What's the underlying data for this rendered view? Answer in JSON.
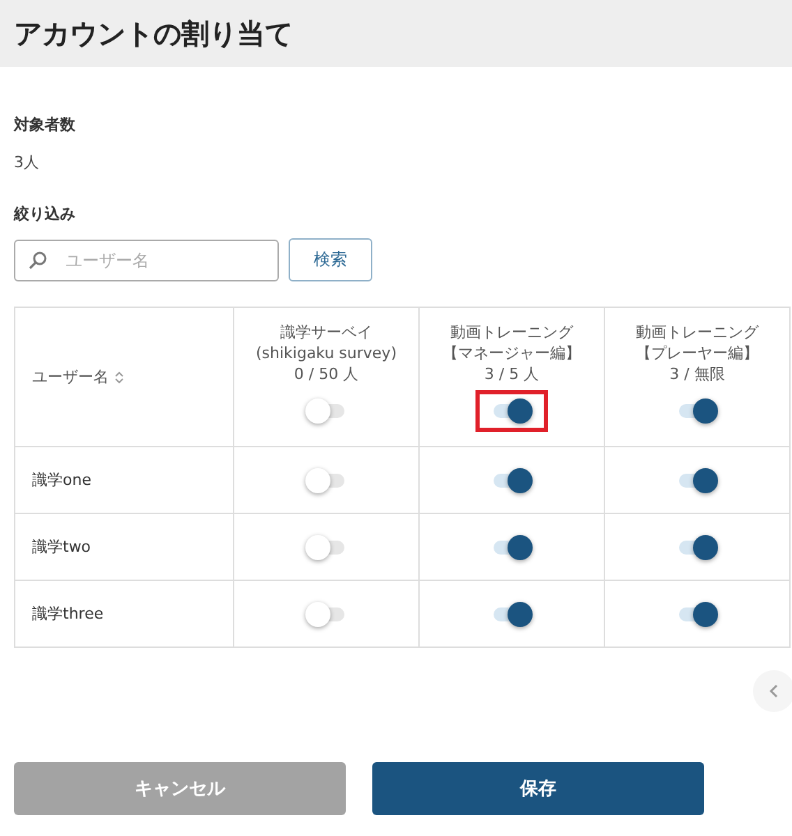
{
  "header": {
    "title": "アカウントの割り当て"
  },
  "target_count": {
    "label": "対象者数",
    "value": "3人"
  },
  "filter": {
    "label": "絞り込み",
    "placeholder": "ユーザー名",
    "search_button": "検索"
  },
  "table": {
    "name_column": "ユーザー名",
    "columns": [
      {
        "lines": [
          "識学サーベイ",
          "(shikigaku survey)",
          "0 / 50 人"
        ],
        "on": false,
        "highlighted": false
      },
      {
        "lines": [
          "動画トレーニング",
          "【マネージャー編】",
          "3 / 5 人"
        ],
        "on": true,
        "highlighted": true
      },
      {
        "lines": [
          "動画トレーニング",
          "【プレーヤー編】",
          "3 / 無限"
        ],
        "on": true,
        "highlighted": false
      }
    ],
    "rows": [
      {
        "name": "識学one",
        "toggles": [
          false,
          true,
          true
        ]
      },
      {
        "name": "識学two",
        "toggles": [
          false,
          true,
          true
        ]
      },
      {
        "name": "識学three",
        "toggles": [
          false,
          true,
          true
        ]
      }
    ]
  },
  "buttons": {
    "cancel": "キャンセル",
    "save": "保存"
  }
}
